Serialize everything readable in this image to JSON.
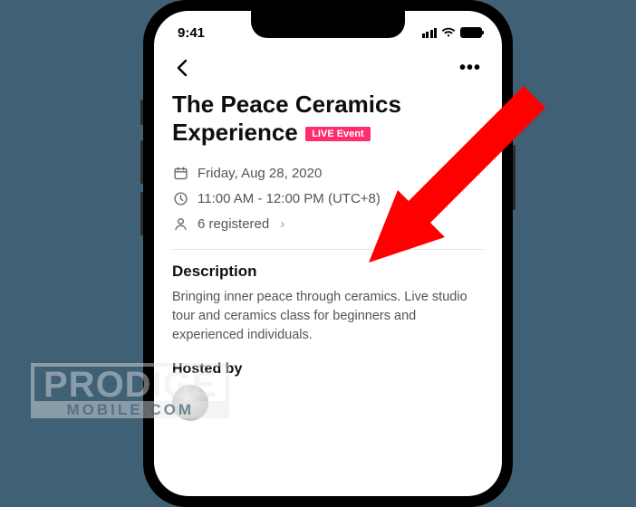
{
  "statusbar": {
    "time": "9:41"
  },
  "event": {
    "title": "The Peace Ceramics Experience",
    "badge": "LIVE Event",
    "date": "Friday, Aug 28, 2020",
    "time": "11:00 AM - 12:00 PM (UTC+8)",
    "registered": "6 registered"
  },
  "sections": {
    "description_heading": "Description",
    "description_body": "Bringing inner peace through ceramics. Live studio tour and ceramics class for beginners and experienced individuals.",
    "hosted_heading": "Hosted by"
  },
  "watermark": {
    "top": "PRODIGE",
    "bottom": "MOBILE.COM"
  }
}
